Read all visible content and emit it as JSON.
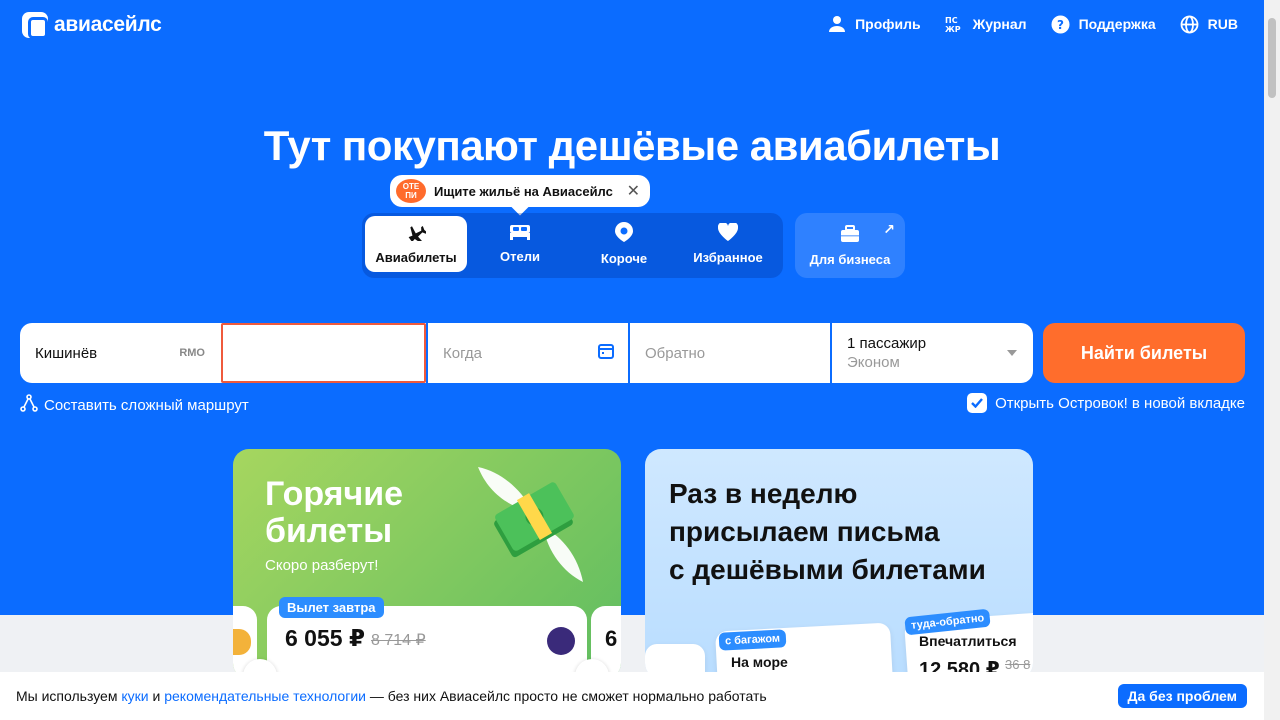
{
  "header": {
    "logo_text": "авиасейлс",
    "nav": [
      {
        "label": "Профиль",
        "icon": "user-icon"
      },
      {
        "label": "Журнал",
        "icon": "journal-icon"
      },
      {
        "label": "Поддержка",
        "icon": "help-icon"
      },
      {
        "label": "RUB",
        "icon": "globe-icon"
      }
    ]
  },
  "hero": {
    "title": "Тут покупают дешёвые авиабилеты",
    "promo": {
      "badge": "ОТЕ ПИ",
      "text": "Ищите жильё на Авиасейлс"
    },
    "tabs": [
      {
        "label": "Авиабилеты",
        "icon": "plane-icon",
        "active": true
      },
      {
        "label": "Отели",
        "icon": "bed-icon"
      },
      {
        "label": "Короче",
        "icon": "location-pin-icon"
      },
      {
        "label": "Избранное",
        "icon": "heart-icon"
      }
    ],
    "business_tab": {
      "label": "Для бизнеса",
      "icon": "briefcase-icon"
    }
  },
  "search": {
    "origin": {
      "value": "Кишинёв",
      "code": "RMO"
    },
    "destination": {
      "value": ""
    },
    "date": {
      "placeholder": "Когда"
    },
    "return": {
      "placeholder": "Обратно"
    },
    "passengers": {
      "value": "1 пассажир",
      "class": "Эконом"
    },
    "submit_label": "Найти билеты",
    "complex_route": "Составить сложный маршрут",
    "open_hotel_checkbox": {
      "label": "Открыть Островок! в новой вкладке",
      "checked": true
    }
  },
  "cards": {
    "hot": {
      "title_line1": "Горячие",
      "title_line2": "билеты",
      "subtitle": "Скоро разберут!",
      "deal": {
        "badge": "Вылет завтра",
        "price": "6 055 ₽",
        "old_price": "8 714 ₽"
      },
      "next_price_peek": "6"
    },
    "newsletter": {
      "title_line1": "Раз в неделю",
      "title_line2": "присылаем письма",
      "title_line3": "с дешёвыми билетами",
      "mini1": {
        "tag": "с багажом",
        "text": "На море"
      },
      "mini2": {
        "tag": "туда-обратно",
        "text": "Впечатлиться",
        "price": "12 580 ₽",
        "old_price": "36 8"
      }
    }
  },
  "cookie": {
    "text_before": "Мы используем ",
    "link1": "куки",
    "text_and": " и ",
    "link2": "рекомендательные технологии",
    "text_after": " — без них Авиасейлс просто не сможет нормально работать",
    "button": "Да без проблем"
  },
  "colors": {
    "brand": "#0b6cff",
    "accent": "#ff6d2c"
  }
}
